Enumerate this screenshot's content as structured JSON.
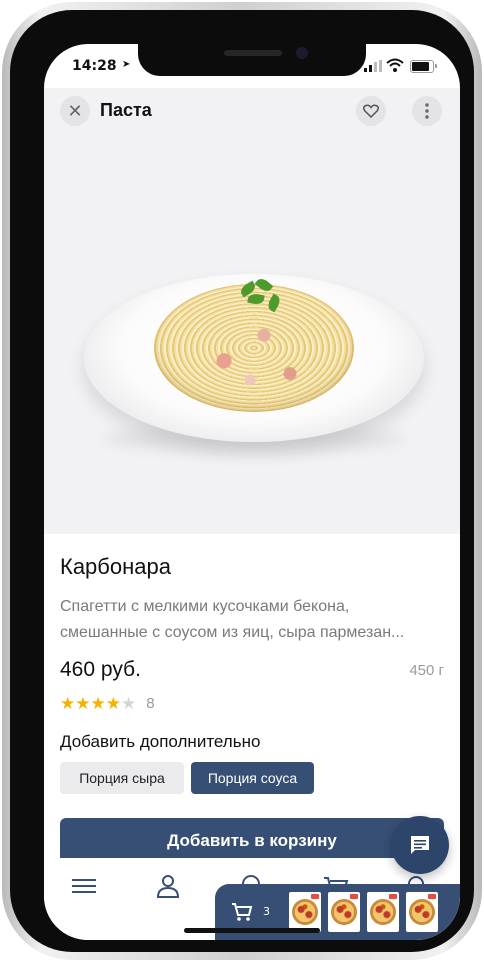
{
  "status_bar": {
    "time": "14:28"
  },
  "header": {
    "title": "Паста"
  },
  "product": {
    "name": "Карбонара",
    "description_lines": [
      "Спагетти с мелкими кусочками бекона,",
      "смешанные с соусом из яиц, сыра пармезан..."
    ],
    "price": "460 руб.",
    "weight": "450 г",
    "rating": {
      "stars_filled": 4,
      "stars_total": 5,
      "count": "8"
    }
  },
  "addons": {
    "title": "Добавить дополнительно",
    "options": [
      {
        "label": "Порция сыра",
        "selected": false
      },
      {
        "label": "Порция соуса",
        "selected": true
      }
    ]
  },
  "add_to_cart_label": "Добавить в корзину",
  "tabbar": {
    "items": [
      "menu-icon",
      "profile-icon",
      "search-icon",
      "cart-icon",
      "location-icon"
    ]
  },
  "cart_widget": {
    "count": "3",
    "items": [
      "pizza",
      "pizza",
      "pizza",
      "pizza"
    ]
  },
  "colors": {
    "accent": "#374f74",
    "star_filled": "#f5b301",
    "star_empty": "#d6d6d6"
  }
}
